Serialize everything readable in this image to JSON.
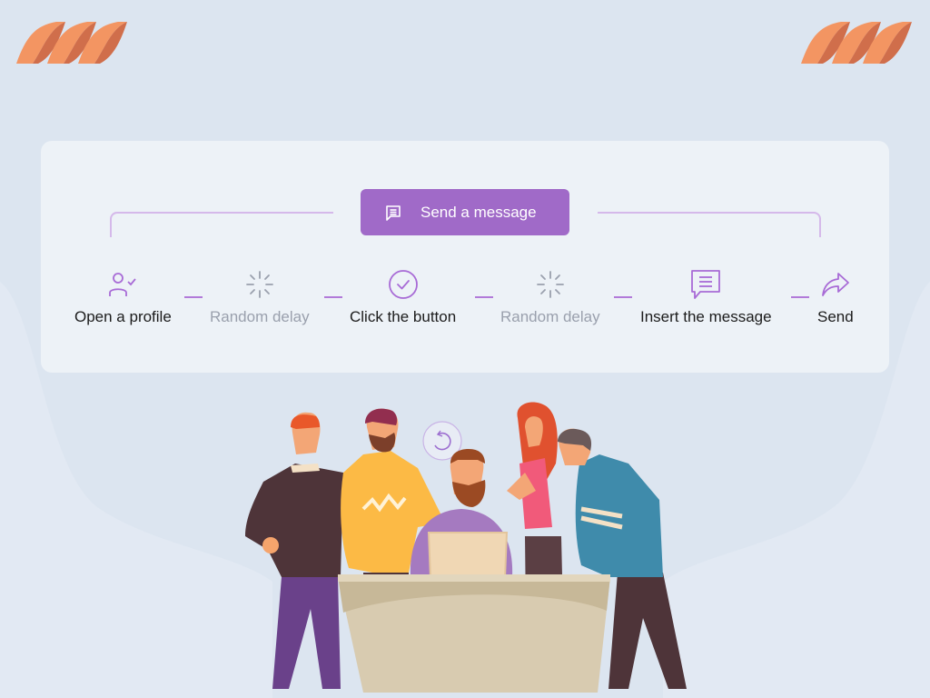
{
  "brand": {
    "accent": "#a06ac8",
    "logo_color": "#f39562",
    "logo_shadow": "#d06e4b"
  },
  "card": {
    "button": {
      "label": "Send a message",
      "icon": "message-icon"
    },
    "steps": [
      {
        "label": "Open a profile",
        "icon": "user-check-icon",
        "muted": false
      },
      {
        "label": "Random delay",
        "icon": "loading-spinner-icon",
        "muted": true
      },
      {
        "label": "Click the button",
        "icon": "check-circle-icon",
        "muted": false
      },
      {
        "label": "Random delay",
        "icon": "loading-spinner-icon",
        "muted": true
      },
      {
        "label": "Insert the message",
        "icon": "message-icon",
        "muted": false
      },
      {
        "label": "Send",
        "icon": "share-arrow-icon",
        "muted": false
      }
    ]
  },
  "illustration": {
    "description": "Five people gathered around a desk with a laptop",
    "bubble_icon": "refresh-icon"
  }
}
